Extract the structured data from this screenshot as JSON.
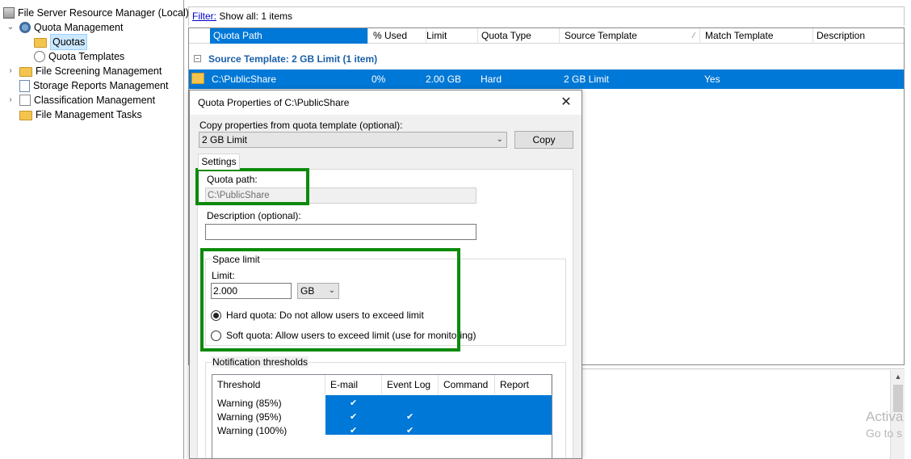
{
  "tree": {
    "root": "File Server Resource Manager (Local)",
    "quota_management": "Quota Management",
    "quotas": "Quotas",
    "quota_templates": "Quota Templates",
    "file_screening": "File Screening Management",
    "storage_reports": "Storage Reports Management",
    "classification": "Classification Management",
    "file_management_tasks": "File Management Tasks"
  },
  "filter": {
    "link": "Filter:",
    "text": "Show all: 1 items"
  },
  "grid": {
    "columns": [
      "Quota Path",
      "% Used",
      "Limit",
      "Quota Type",
      "Source Template",
      "Match Template",
      "Description"
    ],
    "group_label": "Source Template: 2 GB Limit (1 item)",
    "group_toggle": "−",
    "row": {
      "path": "C:\\PublicShare",
      "used": "0%",
      "limit": "2.00 GB",
      "type": "Hard",
      "source_template": "2 GB Limit",
      "match_template": "Yes",
      "description": ""
    }
  },
  "dialog": {
    "title": "Quota Properties of C:\\PublicShare",
    "close_glyph": "✕",
    "copy_label": "Copy properties from quota template (optional):",
    "copy_select_value": "2 GB Limit",
    "copy_button": "Copy",
    "tab_settings": "Settings",
    "quota_path_label": "Quota path:",
    "quota_path_value": "C:\\PublicShare",
    "description_label": "Description (optional):",
    "description_value": "",
    "space_limit_title": "Space limit",
    "limit_label": "Limit:",
    "limit_value": "2.000",
    "unit_value": "GB",
    "hard_quota_label": "Hard quota: Do not allow users to exceed limit",
    "soft_quota_label": "Soft quota: Allow users to exceed limit (use for monitoring)",
    "hard_quota_selected": true,
    "notification_title": "Notification thresholds",
    "notif_columns": [
      "Threshold",
      "E-mail",
      "Event Log",
      "Command",
      "Report"
    ],
    "notif_rows": [
      {
        "threshold": "Warning (85%)",
        "email": "✔",
        "eventlog": "",
        "command": "",
        "report": ""
      },
      {
        "threshold": "Warning (95%)",
        "email": "✔",
        "eventlog": "✔",
        "command": "",
        "report": ""
      },
      {
        "threshold": "Warning (100%)",
        "email": "✔",
        "eventlog": "✔",
        "command": "",
        "report": ""
      }
    ]
  },
  "watermark": {
    "line1": "Activa",
    "line2": "Go to s"
  },
  "colors": {
    "selection": "#0078d7",
    "annotation": "#0d8a0d",
    "group_text": "#1a5fa8"
  },
  "icons": {
    "root": "server-icon",
    "quota_management": "quota-gear-icon",
    "quotas": "folder-icon",
    "quota_templates": "template-icon",
    "file_screening": "folder-icon",
    "storage_reports": "report-icon",
    "classification": "classification-icon",
    "file_management_tasks": "folder-icon"
  }
}
